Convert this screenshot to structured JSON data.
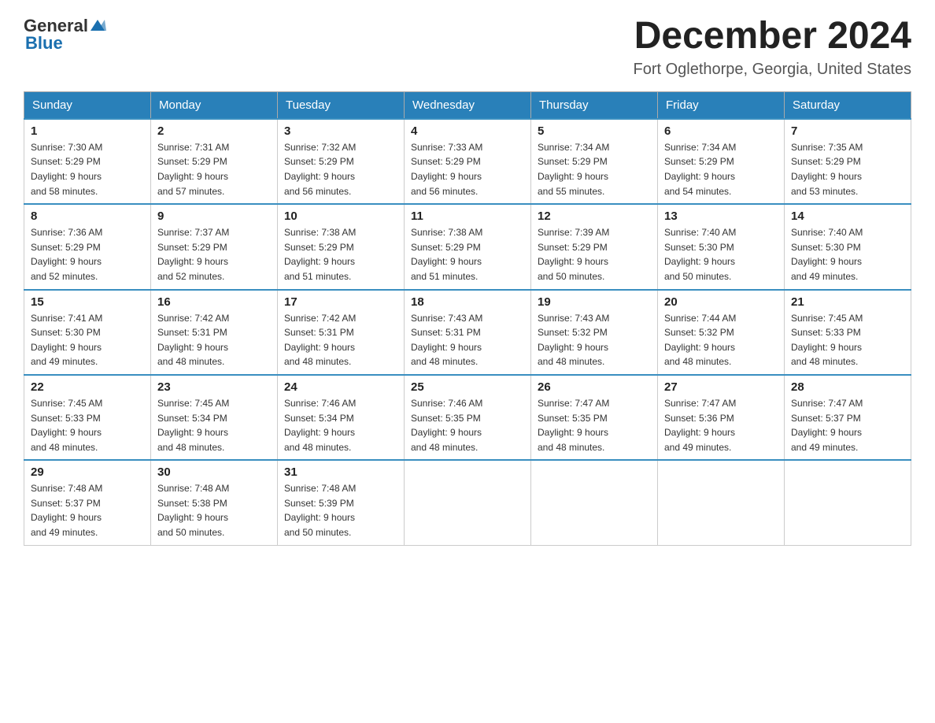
{
  "header": {
    "logo_general": "General",
    "logo_blue": "Blue",
    "month_title": "December 2024",
    "location": "Fort Oglethorpe, Georgia, United States"
  },
  "days_of_week": [
    "Sunday",
    "Monday",
    "Tuesday",
    "Wednesday",
    "Thursday",
    "Friday",
    "Saturday"
  ],
  "weeks": [
    [
      {
        "day": "1",
        "sunrise": "7:30 AM",
        "sunset": "5:29 PM",
        "daylight": "9 hours and 58 minutes."
      },
      {
        "day": "2",
        "sunrise": "7:31 AM",
        "sunset": "5:29 PM",
        "daylight": "9 hours and 57 minutes."
      },
      {
        "day": "3",
        "sunrise": "7:32 AM",
        "sunset": "5:29 PM",
        "daylight": "9 hours and 56 minutes."
      },
      {
        "day": "4",
        "sunrise": "7:33 AM",
        "sunset": "5:29 PM",
        "daylight": "9 hours and 56 minutes."
      },
      {
        "day": "5",
        "sunrise": "7:34 AM",
        "sunset": "5:29 PM",
        "daylight": "9 hours and 55 minutes."
      },
      {
        "day": "6",
        "sunrise": "7:34 AM",
        "sunset": "5:29 PM",
        "daylight": "9 hours and 54 minutes."
      },
      {
        "day": "7",
        "sunrise": "7:35 AM",
        "sunset": "5:29 PM",
        "daylight": "9 hours and 53 minutes."
      }
    ],
    [
      {
        "day": "8",
        "sunrise": "7:36 AM",
        "sunset": "5:29 PM",
        "daylight": "9 hours and 52 minutes."
      },
      {
        "day": "9",
        "sunrise": "7:37 AM",
        "sunset": "5:29 PM",
        "daylight": "9 hours and 52 minutes."
      },
      {
        "day": "10",
        "sunrise": "7:38 AM",
        "sunset": "5:29 PM",
        "daylight": "9 hours and 51 minutes."
      },
      {
        "day": "11",
        "sunrise": "7:38 AM",
        "sunset": "5:29 PM",
        "daylight": "9 hours and 51 minutes."
      },
      {
        "day": "12",
        "sunrise": "7:39 AM",
        "sunset": "5:29 PM",
        "daylight": "9 hours and 50 minutes."
      },
      {
        "day": "13",
        "sunrise": "7:40 AM",
        "sunset": "5:30 PM",
        "daylight": "9 hours and 50 minutes."
      },
      {
        "day": "14",
        "sunrise": "7:40 AM",
        "sunset": "5:30 PM",
        "daylight": "9 hours and 49 minutes."
      }
    ],
    [
      {
        "day": "15",
        "sunrise": "7:41 AM",
        "sunset": "5:30 PM",
        "daylight": "9 hours and 49 minutes."
      },
      {
        "day": "16",
        "sunrise": "7:42 AM",
        "sunset": "5:31 PM",
        "daylight": "9 hours and 48 minutes."
      },
      {
        "day": "17",
        "sunrise": "7:42 AM",
        "sunset": "5:31 PM",
        "daylight": "9 hours and 48 minutes."
      },
      {
        "day": "18",
        "sunrise": "7:43 AM",
        "sunset": "5:31 PM",
        "daylight": "9 hours and 48 minutes."
      },
      {
        "day": "19",
        "sunrise": "7:43 AM",
        "sunset": "5:32 PM",
        "daylight": "9 hours and 48 minutes."
      },
      {
        "day": "20",
        "sunrise": "7:44 AM",
        "sunset": "5:32 PM",
        "daylight": "9 hours and 48 minutes."
      },
      {
        "day": "21",
        "sunrise": "7:45 AM",
        "sunset": "5:33 PM",
        "daylight": "9 hours and 48 minutes."
      }
    ],
    [
      {
        "day": "22",
        "sunrise": "7:45 AM",
        "sunset": "5:33 PM",
        "daylight": "9 hours and 48 minutes."
      },
      {
        "day": "23",
        "sunrise": "7:45 AM",
        "sunset": "5:34 PM",
        "daylight": "9 hours and 48 minutes."
      },
      {
        "day": "24",
        "sunrise": "7:46 AM",
        "sunset": "5:34 PM",
        "daylight": "9 hours and 48 minutes."
      },
      {
        "day": "25",
        "sunrise": "7:46 AM",
        "sunset": "5:35 PM",
        "daylight": "9 hours and 48 minutes."
      },
      {
        "day": "26",
        "sunrise": "7:47 AM",
        "sunset": "5:35 PM",
        "daylight": "9 hours and 48 minutes."
      },
      {
        "day": "27",
        "sunrise": "7:47 AM",
        "sunset": "5:36 PM",
        "daylight": "9 hours and 49 minutes."
      },
      {
        "day": "28",
        "sunrise": "7:47 AM",
        "sunset": "5:37 PM",
        "daylight": "9 hours and 49 minutes."
      }
    ],
    [
      {
        "day": "29",
        "sunrise": "7:48 AM",
        "sunset": "5:37 PM",
        "daylight": "9 hours and 49 minutes."
      },
      {
        "day": "30",
        "sunrise": "7:48 AM",
        "sunset": "5:38 PM",
        "daylight": "9 hours and 50 minutes."
      },
      {
        "day": "31",
        "sunrise": "7:48 AM",
        "sunset": "5:39 PM",
        "daylight": "9 hours and 50 minutes."
      },
      null,
      null,
      null,
      null
    ]
  ]
}
